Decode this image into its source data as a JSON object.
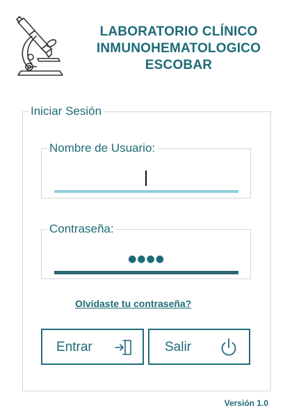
{
  "header": {
    "logo_icon": "microscope-icon",
    "title_lines": [
      "LABORATORIO CLÍNICO",
      "INMUNOHEMATOLOGICO",
      "ESCOBAR"
    ]
  },
  "login": {
    "group_label": "Iniciar Sesión",
    "username": {
      "label": "Nombre de Usuario:",
      "value": ""
    },
    "password": {
      "label": "Contraseña:",
      "masked_value": "●●●●"
    },
    "forgot_link": "Olvidaste tu contraseña?",
    "enter_button": {
      "label": "Entrar",
      "icon": "login-icon"
    },
    "exit_button": {
      "label": "Salir",
      "icon": "power-icon"
    }
  },
  "version": "Versión 1.0",
  "colors": {
    "accent": "#1e6b78",
    "username_underline": "#8ecfda",
    "password_underline": "#2b6770",
    "border": "#d6d6d6"
  }
}
